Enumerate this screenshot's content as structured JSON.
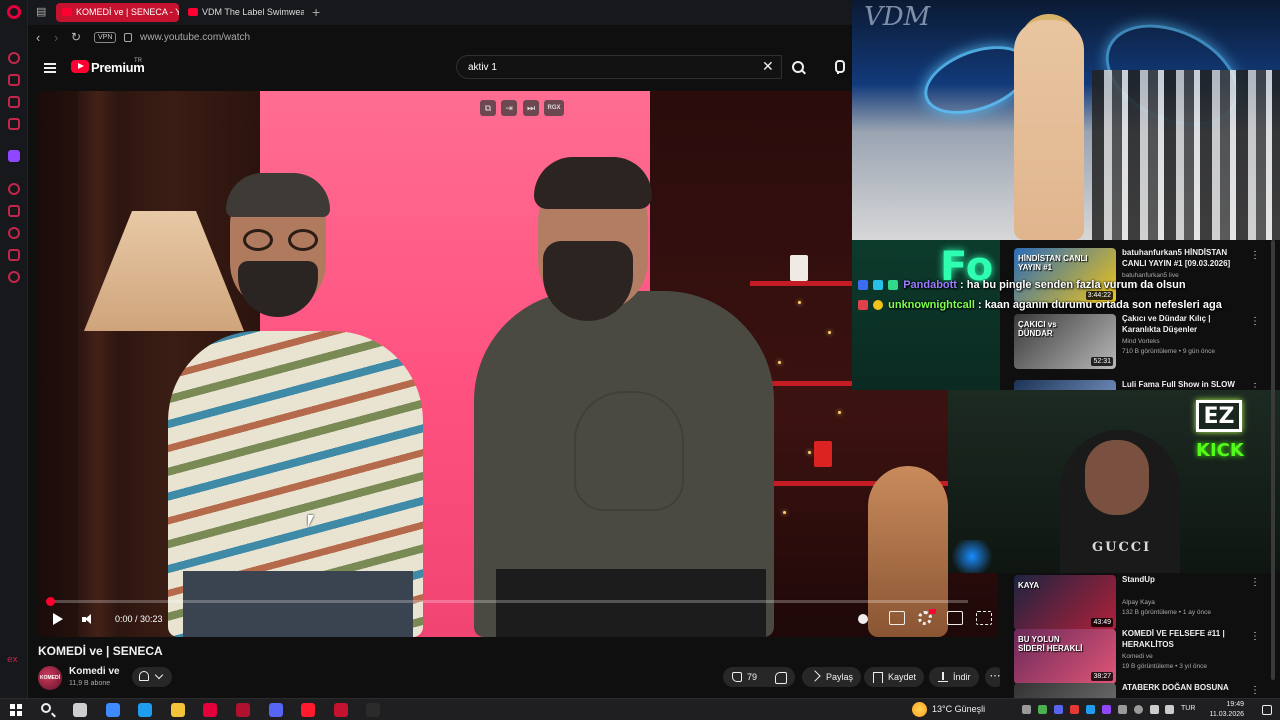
{
  "browser": {
    "tabs": [
      {
        "label": "KOMEDİ ve | SENECA - Yo",
        "active": true
      },
      {
        "label": "VDM The Label Swimwear",
        "active": false
      }
    ],
    "vpn_label": "VPN",
    "url": "www.youtube.com/watch",
    "rail_bottom_label": "ex"
  },
  "youtube": {
    "logo_text": "Premium",
    "region": "TR",
    "search_query": "aktiv 1"
  },
  "player": {
    "time": "0:00 / 30:23",
    "progress_fraction": 0.004,
    "overlay_badge": "RGX"
  },
  "video": {
    "title": "KOMEDİ ve | SENECA",
    "channel_name": "Komedi ve",
    "channel_avatar_text": "KOMEDİ VE",
    "subscribers": "11,9 B abone",
    "likes": "79",
    "share_label": "Paylaş",
    "save_label": "Kaydet",
    "download_label": "İndir",
    "more_label": "⋯"
  },
  "stream_overlay": {
    "watermark": "VDM",
    "neon_sign": "Fo",
    "chat": [
      {
        "user": "Pandabott",
        "user_color": "#9b7bff",
        "message": "ha bu pingle senden fazla vurum da olsun"
      },
      {
        "user": "unknownightcall",
        "user_color": "#7dff4d",
        "message": "kaan aganın durumu ortada son nefesleri aga"
      }
    ],
    "cam_shirt_text": "GUCCI",
    "ez_badge": "EZ",
    "kick_label": "KICK"
  },
  "recommendations_top": [
    {
      "title": "batuhanfurkan5 HİNDİSTAN CANLI YAYIN #1 [09.03.2026]",
      "channel": "batuhanfurkan5 live",
      "meta": "1 gün önce",
      "duration": "3:44:22",
      "thumb_colors": [
        "#2a6bb8",
        "#f0c419"
      ],
      "thumb_text": "HİNDİSTAN CANLI YAYIN #1"
    },
    {
      "title": "Çakıcı ve Dündar Kılıç | Karanlıkta Düşenler",
      "channel": "Mind Vorteks",
      "meta": "710 B görüntüleme • 9 gün önce",
      "duration": "52:31",
      "thumb_colors": [
        "#3a3a3a",
        "#b8b8b8"
      ],
      "thumb_text": "ÇAKICI vs DÜNDAR"
    },
    {
      "title": "Luli Fama Full Show in SLOW",
      "channel": "",
      "meta": "",
      "duration": "",
      "thumb_colors": [
        "#1c3355",
        "#87a6d8"
      ],
      "thumb_text": ""
    }
  ],
  "recommendations_bottom": [
    {
      "title": "StandUp",
      "channel": "Alpay Kaya",
      "meta": "132 B görüntüleme • 1 ay önce",
      "duration": "43:49",
      "thumb_colors": [
        "#1d2440",
        "#b0203a"
      ],
      "thumb_text": "KAYA"
    },
    {
      "title": "KOMEDİ VE FELSEFE #11 | HERAKLİTOS",
      "channel": "Komedi ve",
      "meta": "19 B görüntüleme • 3 yıl önce",
      "duration": "38:27",
      "thumb_colors": [
        "#6a2a5a",
        "#e25577"
      ],
      "thumb_text": "BU YOLUN SİDERİ HERAKLİ"
    },
    {
      "title": "ATABERK DOĞAN BOSUNA",
      "channel": "",
      "meta": "",
      "duration": "",
      "thumb_colors": [
        "#333",
        "#777"
      ],
      "thumb_text": ""
    }
  ],
  "taskbar": {
    "weather": "13°C  Güneşli",
    "language": "TUR",
    "time": "19:49",
    "date": "11.03.2026",
    "apps": [
      {
        "name": "task-view-icon",
        "color": "#cfcfcf"
      },
      {
        "name": "copilot-icon",
        "color": "#3d8bff"
      },
      {
        "name": "edge-icon",
        "color": "#1f9cf0"
      },
      {
        "name": "file-explorer-icon",
        "color": "#f3c33a"
      },
      {
        "name": "opera-gx-icon",
        "color": "#e4003a"
      },
      {
        "name": "video-editor-icon",
        "color": "#b2102f"
      },
      {
        "name": "discord-icon",
        "color": "#5865f2"
      },
      {
        "name": "opera-icon",
        "color": "#ff1b2d"
      },
      {
        "name": "opera-active-icon",
        "color": "#c4122f"
      },
      {
        "name": "epic-games-icon",
        "color": "#2b2b2b"
      }
    ]
  }
}
